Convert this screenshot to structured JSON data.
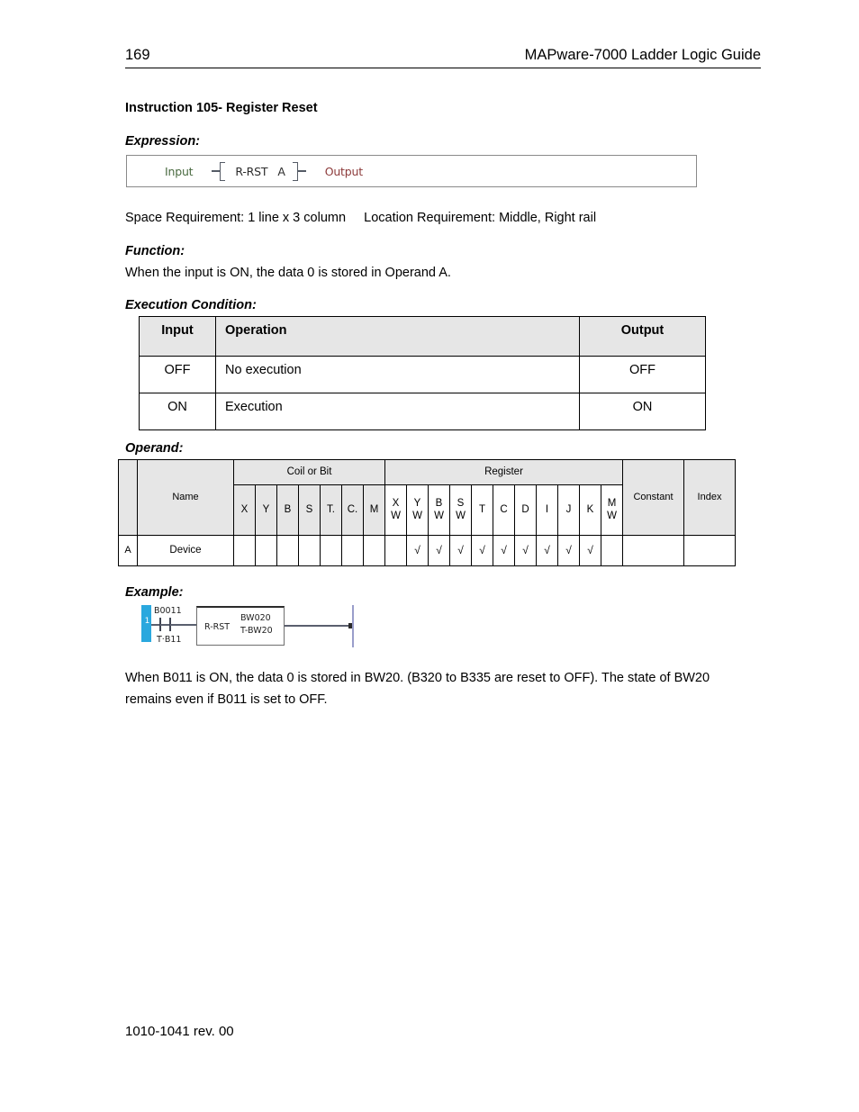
{
  "header": {
    "page_number": "169",
    "title": "MAPware-7000 Ladder Logic Guide"
  },
  "instruction": {
    "title": "Instruction 105- Register Reset"
  },
  "labels": {
    "expression": "Expression:",
    "function": "Function:",
    "execution_condition": "Execution Condition:",
    "operand": "Operand:",
    "example": "Example:"
  },
  "expression": {
    "input_label": "Input",
    "operator": "R-RST",
    "operand_a": "A",
    "output_label": "Output",
    "input_color": "#4a6b41",
    "output_color": "#8c3a3a"
  },
  "requirements": {
    "text": "Space Requirement: 1 line x 3 column     Location Requirement: Middle, Right rail"
  },
  "function": {
    "text": "When the input is ON, the data 0 is stored in Operand A."
  },
  "execution_table": {
    "headers": [
      "Input",
      "Operation",
      "Output"
    ],
    "rows": [
      [
        "OFF",
        "No execution",
        "OFF"
      ],
      [
        "ON",
        "Execution",
        "ON"
      ]
    ]
  },
  "operand_table": {
    "group_headers": {
      "coil_or_bit": "Coil or Bit",
      "register": "Register",
      "constant": "Constant",
      "index": "Index"
    },
    "name_header": "Name",
    "coil_columns": [
      "X",
      "Y",
      "B",
      "S",
      "T.",
      "C.",
      "M"
    ],
    "register_columns": [
      {
        "top": "X",
        "bottom": "W"
      },
      {
        "top": "Y",
        "bottom": "W"
      },
      {
        "top": "B",
        "bottom": "W"
      },
      {
        "top": "S",
        "bottom": "W"
      },
      {
        "top": "T",
        "bottom": ""
      },
      {
        "top": "C",
        "bottom": ""
      },
      {
        "top": "D",
        "bottom": ""
      },
      {
        "top": "I",
        "bottom": ""
      },
      {
        "top": "J",
        "bottom": ""
      },
      {
        "top": "K",
        "bottom": ""
      },
      {
        "top": "M",
        "bottom": "W"
      }
    ],
    "rows": [
      {
        "index": "A",
        "name": "Device",
        "coil_marks": [
          "",
          "",
          "",
          "",
          "",
          "",
          ""
        ],
        "register_marks": [
          "",
          "√",
          "√",
          "√",
          "√",
          "√",
          "√",
          "√",
          "√",
          "√",
          ""
        ],
        "constant": "",
        "index_mark": ""
      }
    ]
  },
  "example_ladder": {
    "rung_number": "1",
    "contact_label_top": "B0011",
    "contact_label_bottom": "T·B11",
    "instruction_name": "R-RST",
    "operand_top": "BW020",
    "operand_bottom": "T-BW20",
    "rail_color": "#2aa8de"
  },
  "example": {
    "text": "When B011 is ON, the data 0 is stored in BW20. (B320 to B335 are reset to OFF). The state of BW20 remains even if B011 is set to OFF."
  },
  "footer": {
    "text": "1010-1041 rev. 00"
  }
}
